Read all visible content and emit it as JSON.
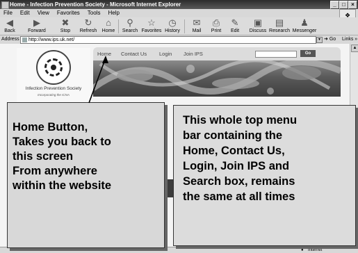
{
  "window": {
    "title": "Home - Infection Prevention Society - Microsoft Internet Explorer",
    "controls": [
      "_",
      "□",
      "×"
    ]
  },
  "menubar": {
    "items": [
      "File",
      "Edit",
      "View",
      "Favorites",
      "Tools",
      "Help"
    ]
  },
  "toolbar": {
    "buttons": [
      {
        "label": "Back",
        "icon": "back-arrow-icon"
      },
      {
        "label": "Forward",
        "icon": "forward-arrow-icon"
      },
      {
        "label": "Stop",
        "icon": "stop-icon"
      },
      {
        "label": "Refresh",
        "icon": "refresh-icon"
      },
      {
        "label": "Home",
        "icon": "home-icon"
      },
      {
        "label": "Search",
        "icon": "search-icon"
      },
      {
        "label": "Favorites",
        "icon": "star-icon"
      },
      {
        "label": "History",
        "icon": "history-icon"
      },
      {
        "label": "Mail",
        "icon": "mail-icon"
      },
      {
        "label": "Print",
        "icon": "print-icon"
      },
      {
        "label": "Edit",
        "icon": "edit-icon"
      },
      {
        "label": "Discuss",
        "icon": "discuss-icon"
      },
      {
        "label": "Research",
        "icon": "research-icon"
      },
      {
        "label": "Messenger",
        "icon": "messenger-icon"
      }
    ]
  },
  "address": {
    "label": "Address",
    "url": "http://www.ips.uk.net/",
    "go_label": "Go",
    "links_label": "Links"
  },
  "site": {
    "logo_title": "Infection Prevention Society",
    "logo_subtitle": "Incorporating the ICNA",
    "nav": [
      "Home",
      "Contact Us",
      "Login",
      "Join IPS"
    ],
    "search_value": "",
    "search_button": "Go"
  },
  "status": {
    "zone": "Internet"
  },
  "callouts": {
    "left_lines": [
      "Home Button,",
      "Takes you back to",
      "this screen",
      "From anywhere",
      "within the website"
    ],
    "right_lines": [
      "This whole top menu",
      "bar containing the",
      "Home, Contact Us,",
      "Login, Join IPS and",
      "Search box, remains",
      "the same at all times"
    ]
  }
}
